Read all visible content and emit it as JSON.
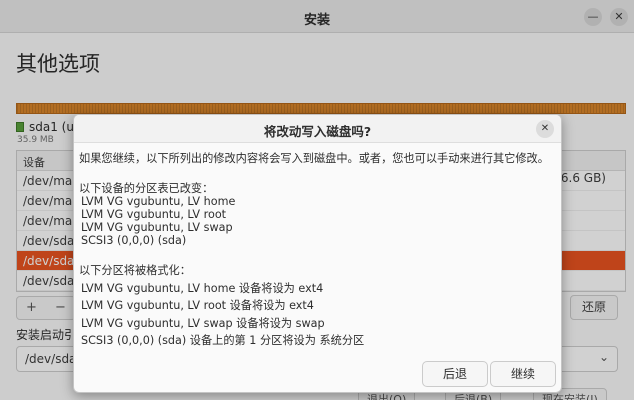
{
  "window": {
    "title": "安装",
    "minimize_icon": "minimize-icon",
    "close_icon": "close-icon"
  },
  "page": {
    "heading": "其他选项"
  },
  "disk": {
    "name": "sda1 (u",
    "size": "35.9 MB",
    "bar_color": "#d9862a",
    "swatch_color": "#5aa03c"
  },
  "table": {
    "header": "设备",
    "rows": [
      "/dev/map",
      "/dev/map",
      "/dev/map",
      "/dev/sda",
      "/dev/sda",
      "/dev/sda"
    ],
    "selected_index": 4,
    "visible_size": "6.6 GB)"
  },
  "toolbar": {
    "add": "+",
    "remove": "−",
    "revert": "还原"
  },
  "boot": {
    "label": "安装启动引",
    "device": "/dev/sda"
  },
  "footer": {
    "b1": "退出(Q)",
    "b2": "后退(B)",
    "b3": "现在安装(I)"
  },
  "dialog": {
    "title": "将改动写入磁盘吗?",
    "intro": "如果您继续，以下所列出的修改内容将会写入到磁盘中。或者，您也可以手动来进行其它修改。",
    "partition_tables_heading": "以下设备的分区表已改变：",
    "partition_tables": [
      "LVM VG vgubuntu, LV home",
      "LVM VG vgubuntu, LV root",
      "LVM VG vgubuntu, LV swap",
      "SCSI3 (0,0,0) (sda)"
    ],
    "formatted_heading": "以下分区将被格式化：",
    "formatted": [
      "LVM VG vgubuntu, LV home 设备将设为 ext4",
      "LVM VG vgubuntu, LV root 设备将设为 ext4",
      "LVM VG vgubuntu, LV swap 设备将设为 swap",
      "SCSI3 (0,0,0) (sda) 设备上的第 1 分区将设为 系统分区"
    ],
    "back_label": "后退",
    "continue_label": "继续"
  }
}
